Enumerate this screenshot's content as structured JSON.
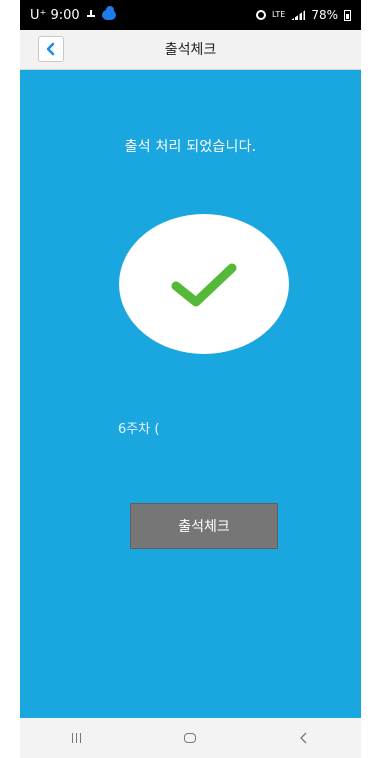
{
  "status_bar": {
    "carrier_time": "U⁺ 9:00",
    "network": "LTE",
    "battery": "78%"
  },
  "header": {
    "title": "출석체크"
  },
  "main": {
    "message": "출석 처리 되었습니다.",
    "week_label": "6주차 (",
    "button_label": "출석체크"
  },
  "colors": {
    "background": "#1aa6de",
    "check": "#56b839",
    "button": "#767676",
    "status_bar": "#000000"
  },
  "icons": [
    "back-arrow-icon",
    "check-icon",
    "recent-apps-icon",
    "home-icon",
    "back-nav-icon"
  ]
}
